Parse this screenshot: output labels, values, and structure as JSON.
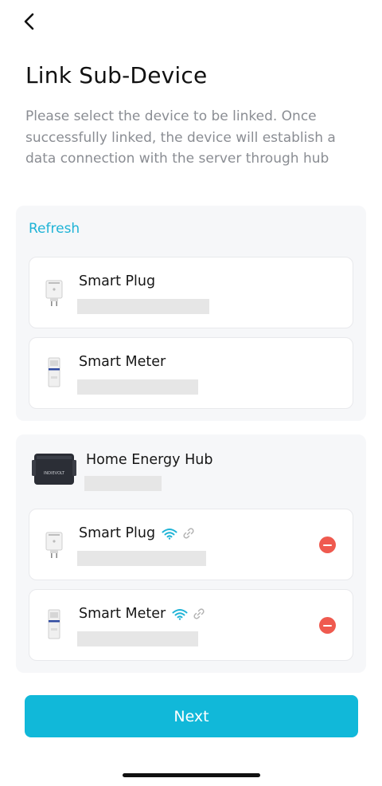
{
  "header": {
    "back_icon": "chevron-left-icon",
    "title": "Link Sub-Device",
    "subtitle": "Please select the device to be linked. Once successfully linked, the device will establish a data connection with the server through hub"
  },
  "available": {
    "refresh_label": "Refresh",
    "devices": [
      {
        "name": "Smart Plug",
        "icon": "smart-plug-icon"
      },
      {
        "name": "Smart Meter",
        "icon": "smart-meter-icon"
      }
    ]
  },
  "hub": {
    "name": "Home Energy Hub",
    "brand_label": "INDIEVOLT",
    "linked_devices": [
      {
        "name": "Smart Plug",
        "icon": "smart-plug-icon",
        "status_icons": [
          "wifi-icon",
          "link-icon"
        ],
        "action": "remove-icon"
      },
      {
        "name": "Smart Meter",
        "icon": "smart-meter-icon",
        "status_icons": [
          "wifi-icon",
          "link-icon"
        ],
        "action": "remove-icon"
      }
    ]
  },
  "footer": {
    "next_label": "Next"
  },
  "colors": {
    "accent": "#11b8d9",
    "link_text": "#1eb3d6",
    "remove": "#ef5a4f",
    "panel_bg": "#f6f7f9",
    "placeholder_bar": "#e6e6e6"
  }
}
